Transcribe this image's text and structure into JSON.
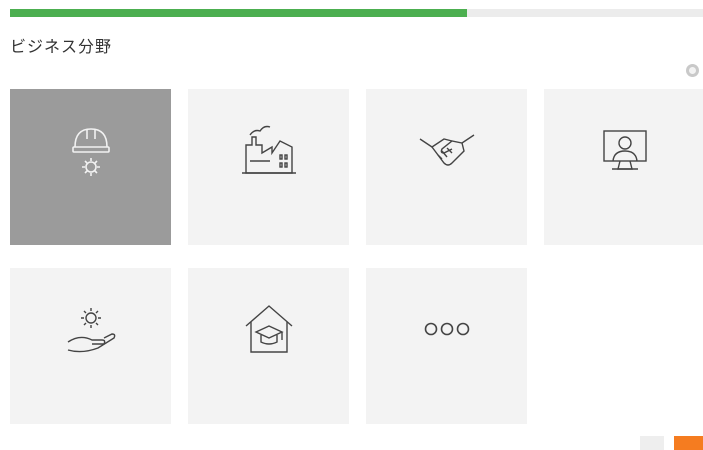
{
  "progress": {
    "fraction": 0.66,
    "label": "",
    "color": "#4caf50"
  },
  "page": {
    "title": "ビジネス分野",
    "subtitle": ""
  },
  "cards": [
    {
      "label": "",
      "icon": "hardhat-gear-icon",
      "selected": true
    },
    {
      "label": "",
      "icon": "factory-icon",
      "selected": false
    },
    {
      "label": "",
      "icon": "handshake-icon",
      "selected": false
    },
    {
      "label": "",
      "icon": "monitor-person-icon",
      "selected": false
    },
    {
      "label": "",
      "icon": "hand-gear-icon",
      "selected": false
    },
    {
      "label": "",
      "icon": "house-graduation-cap-icon",
      "selected": false
    },
    {
      "label": "",
      "icon": "more-dots-icon",
      "selected": false
    }
  ],
  "buttons": {
    "back": "",
    "next": ""
  },
  "colors": {
    "accent": "#f57c20",
    "selected_card": "#9b9b9b",
    "card": "#f3f3f3"
  }
}
